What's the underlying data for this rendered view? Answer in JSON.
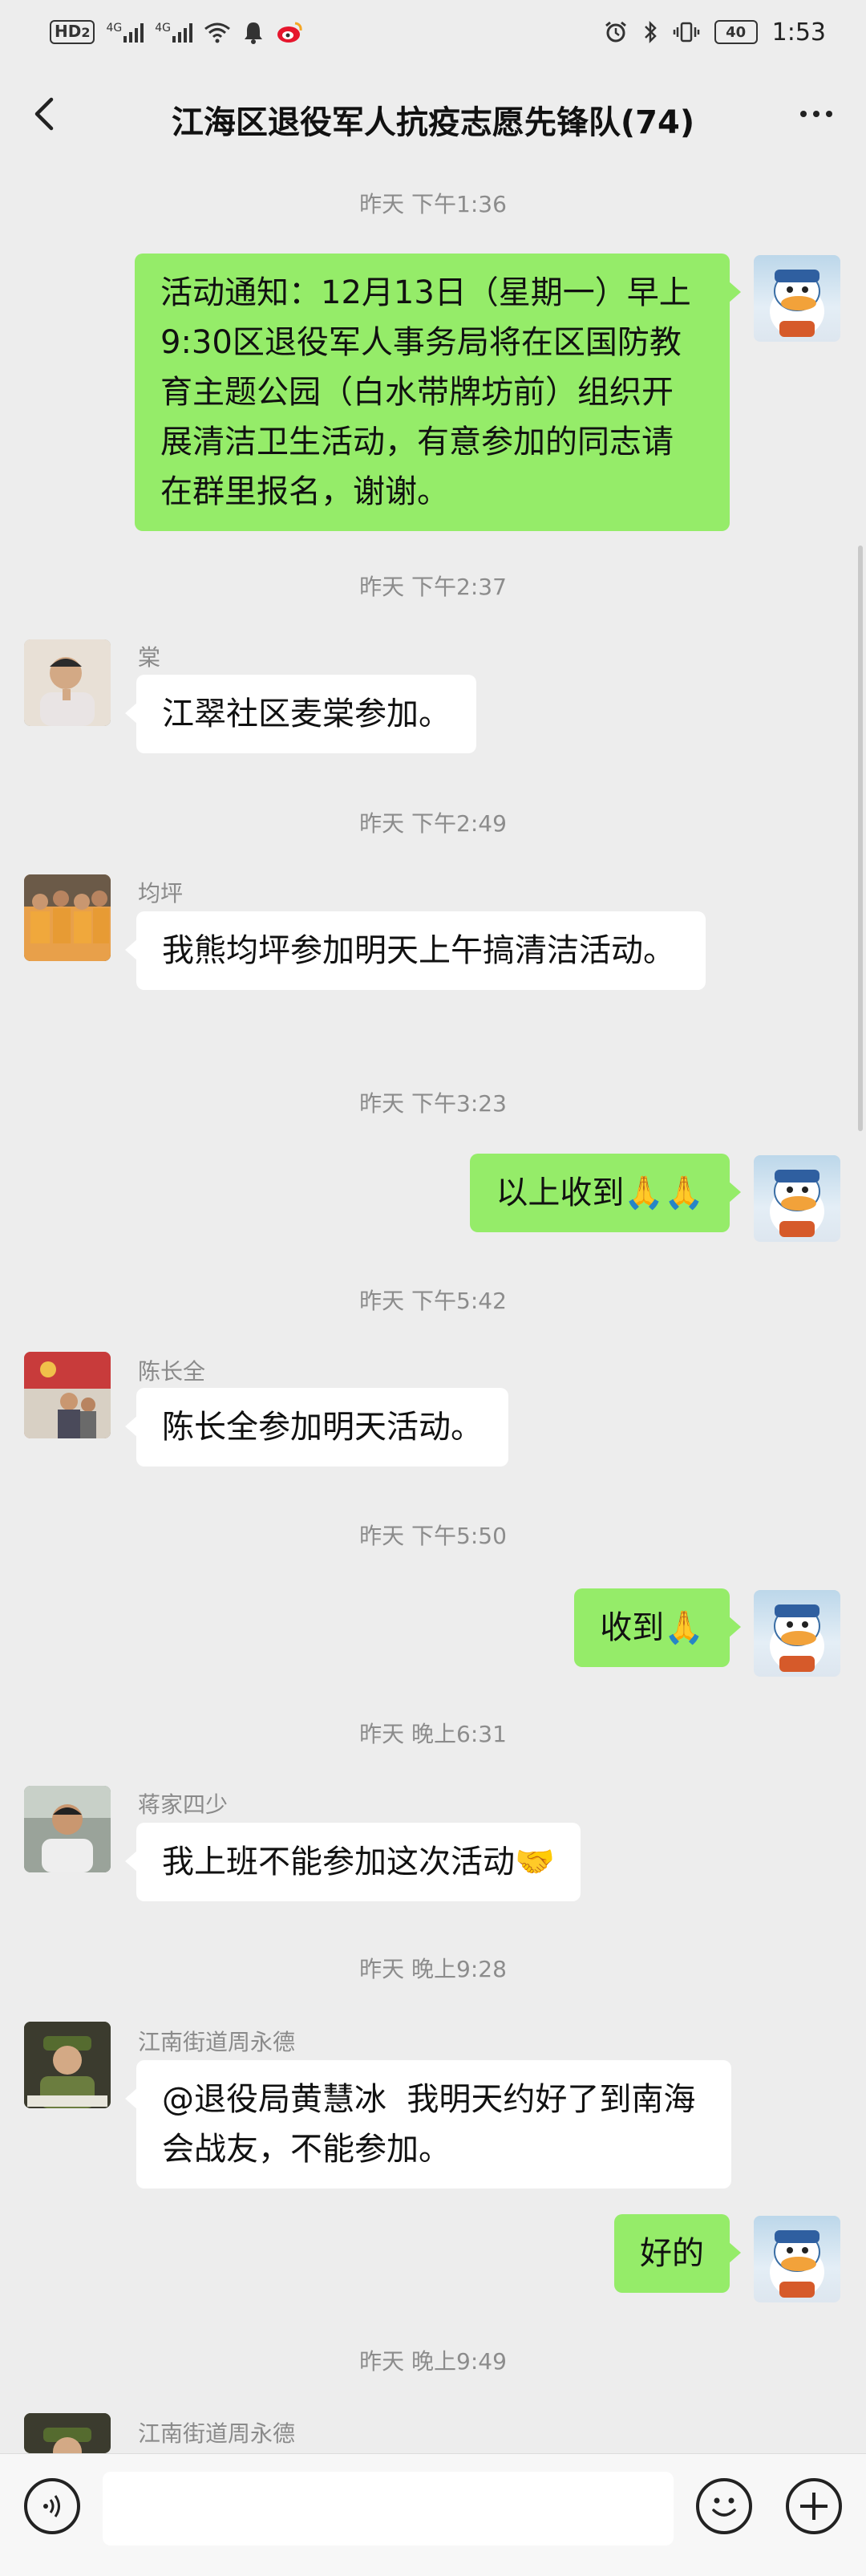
{
  "status_bar": {
    "network_badge": "HD",
    "network_badge_sub": "2",
    "signal1_label": "4G",
    "signal2_label": "4G",
    "battery": "40",
    "time": "1:53"
  },
  "header": {
    "title": "江海区退役军人抗疫志愿先锋队(74)",
    "back_icon": "chevron-left-icon",
    "more_icon": "more-dots-icon"
  },
  "messages": {
    "ts1": "昨天 下午1:36",
    "m1_text": "活动通知：12月13日（星期一）早上9:30区退役军人事务局将在区国防教育主题公园（白水带牌坊前）组织开展清洁卫生活动，有意参加的同志请在群里报名，谢谢。",
    "ts2": "昨天 下午2:37",
    "m2_sender": "棠",
    "m2_text": "江翠社区麦棠参加。",
    "ts3": "昨天 下午2:49",
    "m3_sender": "均坪",
    "m3_text": "我熊均坪参加明天上午搞清洁活动。",
    "ts4": "昨天 下午3:23",
    "m4_text": "以上收到🙏🙏",
    "ts5": "昨天 下午5:42",
    "m5_sender": "陈长全",
    "m5_text": "陈长全参加明天活动。",
    "ts6": "昨天 下午5:50",
    "m6_text": "收到🙏",
    "ts7": "昨天 晚上6:31",
    "m7_sender": "蒋家四少",
    "m7_text": "我上班不能参加这次活动🤝",
    "ts8": "昨天 晚上9:28",
    "m8_sender": "江南街道周永德",
    "m8_text": "@退役局黄慧冰  我明天约好了到南海会战友，不能参加。",
    "m9_text": "好的",
    "ts9": "昨天 晚上9:49",
    "m10_sender": "江南街道周永德"
  },
  "input_bar": {
    "voice_icon": "voice-icon",
    "emoji_icon": "emoji-icon",
    "plus_icon": "plus-icon",
    "input_value": ""
  },
  "colors": {
    "background": "#ededed",
    "outgoing_bubble": "#95ec69",
    "incoming_bubble": "#ffffff"
  }
}
